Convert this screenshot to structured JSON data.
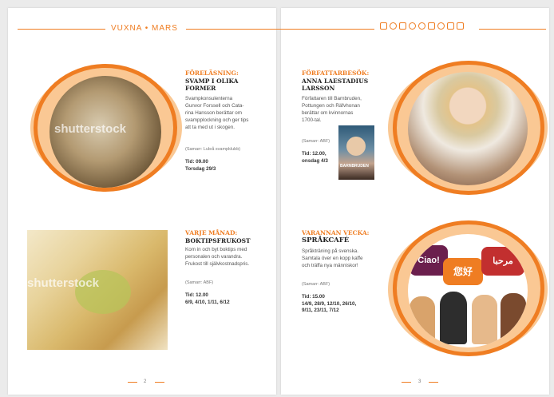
{
  "header": {
    "section": "VUXNA",
    "separator": "•",
    "month": "MARS"
  },
  "header_icons": [
    "building-icon",
    "globe-icon",
    "book-icon",
    "people-icon",
    "disc-icon",
    "laptop-icon",
    "headphones-icon",
    "gamepad-icon",
    "printer-icon"
  ],
  "events": [
    {
      "category": "FÖRELÄSNING:",
      "title_line1": "SVAMP I OLIKA",
      "title_line2": "FORMER",
      "body": [
        "Svampkonsulenterna",
        "Gunvor Forssell och Cata-",
        "rina Hansson berättar om",
        "svampplockning och ger tips",
        "att ta med ut i skogen."
      ],
      "organizer": "(Samarr: Luleå svampklubb)",
      "time": "Tid: 09.00",
      "date": "Torsdag 29/3"
    },
    {
      "category": "FÖRFATTARBESÖK:",
      "title_line1": "ANNA LAESTADIUS",
      "title_line2": "LARSSON",
      "body": [
        "Författaren till Barnbruden,",
        "Pottungen och Räfvhonan",
        "berättar om kvinnornas",
        "1700-tal."
      ],
      "organizer": "(Samarr: ABF)",
      "time": "Tid: 12.00,",
      "date": "onsdag 4/3",
      "book_title": "BARNBRUDEN"
    },
    {
      "category": "VARJE MÅNAD:",
      "title_line1": "BOKTIPSFRUKOST",
      "body": [
        "Kom in och byt boktips med",
        "personalen och varandra.",
        "Frukost till självkostnadspris."
      ],
      "organizer": "(Samarr: ABF)",
      "time": "Tid: 12.00",
      "date": "6/9, 4/10, 1/11, 6/12"
    },
    {
      "category": "VARANNAN VECKA:",
      "title_line1": "SPRÅKCAFÉ",
      "body": [
        "Språkträning på svenska.",
        "Samtala över en kopp kaffe",
        "och träffa nya människor!"
      ],
      "organizer": "(Samarr: ABF)",
      "time": "Tid: 15.00",
      "date": "14/9, 28/9, 12/10, 26/10,",
      "date2": "9/11, 23/11, 7/12"
    }
  ],
  "speech_bubbles": [
    "Ciao!",
    "您好",
    "مرحبا"
  ],
  "watermark": "shutterstock",
  "page_numbers": [
    "2",
    "3"
  ],
  "colors": {
    "accent": "#ef7d22"
  }
}
